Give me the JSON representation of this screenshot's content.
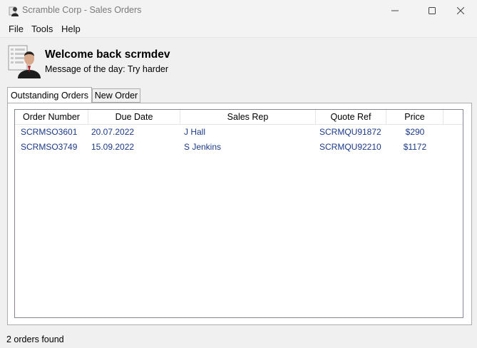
{
  "window": {
    "title": "Scramble Corp - Sales Orders"
  },
  "menu": {
    "items": [
      "File",
      "Tools",
      "Help"
    ]
  },
  "header": {
    "welcome": "Welcome back scrmdev",
    "motd": "Message of the day: Try harder"
  },
  "tabs": [
    {
      "label": "Outstanding Orders",
      "active": true
    },
    {
      "label": "New Order",
      "active": false
    }
  ],
  "orders": {
    "columns": [
      "Order Number",
      "Due Date",
      "Sales Rep",
      "Quote Ref",
      "Price"
    ],
    "rows": [
      [
        "SCRMSO3601",
        "20.07.2022",
        "J Hall",
        "SCRMQU91872",
        "$290"
      ],
      [
        "SCRMSO3749",
        "15.09.2022",
        "S Jenkins",
        "SCRMQU92210",
        "$1172"
      ]
    ]
  },
  "status": {
    "text": "2 orders found"
  },
  "colors": {
    "cell_text": "#1a3a8a",
    "window_bg": "#f0f0f0"
  }
}
